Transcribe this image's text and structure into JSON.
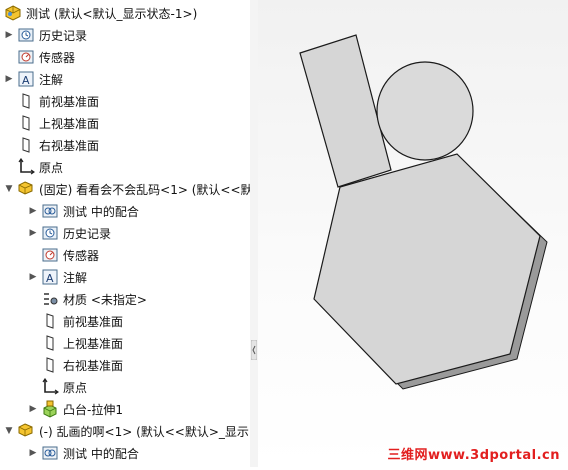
{
  "tree": {
    "root": {
      "label": "测试 (默认<默认_显示状态-1>)",
      "icon": "part-icon"
    },
    "items": [
      {
        "label": "历史记录",
        "icon": "history-icon",
        "indent": 0,
        "arrow": "right"
      },
      {
        "label": "传感器",
        "icon": "sensor-icon",
        "indent": 0,
        "arrow": ""
      },
      {
        "label": "注解",
        "icon": "annotation-icon",
        "indent": 0,
        "arrow": "right"
      },
      {
        "label": "前视基准面",
        "icon": "plane-icon",
        "indent": 0,
        "arrow": ""
      },
      {
        "label": "上视基准面",
        "icon": "plane-icon",
        "indent": 0,
        "arrow": ""
      },
      {
        "label": "右视基准面",
        "icon": "plane-icon",
        "indent": 0,
        "arrow": ""
      },
      {
        "label": "原点",
        "icon": "origin-icon",
        "indent": 0,
        "arrow": ""
      },
      {
        "label": "(固定) 看看会不会乱码<1> (默认<<默",
        "icon": "component-icon",
        "indent": 0,
        "arrow": "down"
      },
      {
        "label": "测试 中的配合",
        "icon": "mates-icon",
        "indent": 1,
        "arrow": "right"
      },
      {
        "label": "历史记录",
        "icon": "history-icon",
        "indent": 1,
        "arrow": "right"
      },
      {
        "label": "传感器",
        "icon": "sensor-icon",
        "indent": 1,
        "arrow": ""
      },
      {
        "label": "注解",
        "icon": "annotation-icon",
        "indent": 1,
        "arrow": "right"
      },
      {
        "label": "材质 <未指定>",
        "icon": "material-icon",
        "indent": 1,
        "arrow": ""
      },
      {
        "label": "前视基准面",
        "icon": "plane-icon",
        "indent": 1,
        "arrow": ""
      },
      {
        "label": "上视基准面",
        "icon": "plane-icon",
        "indent": 1,
        "arrow": ""
      },
      {
        "label": "右视基准面",
        "icon": "plane-icon",
        "indent": 1,
        "arrow": ""
      },
      {
        "label": "原点",
        "icon": "origin-icon",
        "indent": 1,
        "arrow": ""
      },
      {
        "label": "凸台-拉伸1",
        "icon": "extrude-icon",
        "indent": 1,
        "arrow": "right"
      },
      {
        "label": "(-) 乱画的啊<1> (默认<<默认>_显示",
        "icon": "component-icon",
        "indent": 0,
        "arrow": "down"
      },
      {
        "label": "测试 中的配合",
        "icon": "mates-icon",
        "indent": 1,
        "arrow": "right"
      }
    ]
  },
  "watermark": "三维网www.3dportal.cn",
  "colors": {
    "shape_fill": "#d6d6d6",
    "shape_stroke": "#1a1a1a",
    "watermark": "#e21f1f"
  }
}
